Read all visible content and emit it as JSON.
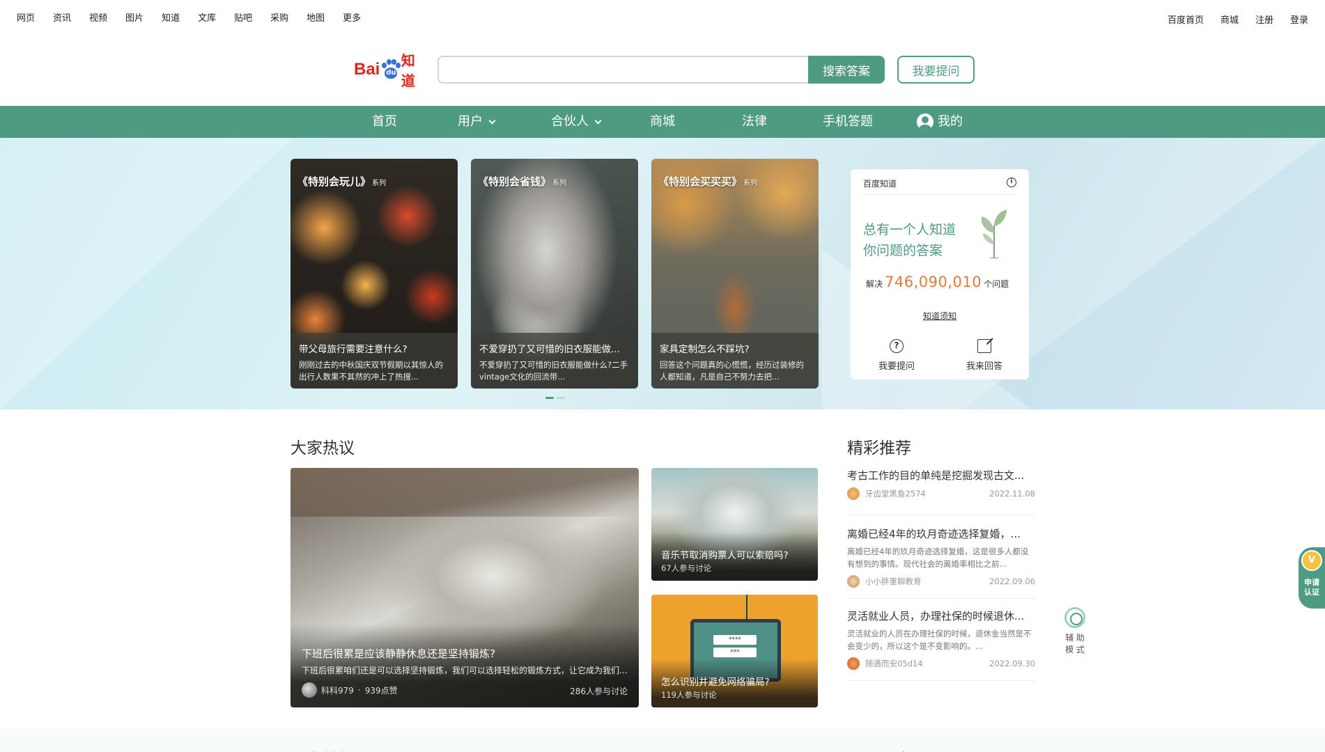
{
  "top_nav": {
    "left": [
      "网页",
      "资讯",
      "视频",
      "图片",
      "知道",
      "文库",
      "贴吧",
      "采购",
      "地图",
      "更多"
    ],
    "right": [
      "百度首页",
      "商城",
      "注册",
      "登录"
    ]
  },
  "logo": {
    "bai": "Bai",
    "du": "du",
    "zhidao": "知道"
  },
  "search": {
    "value": "",
    "placeholder": "",
    "button": "搜索答案",
    "ask_button": "我要提问"
  },
  "main_nav": {
    "home": "首页",
    "user": "用户",
    "partner": "合伙人",
    "mall": "商城",
    "law": "法律",
    "mobile": "手机答题",
    "mine": "我的"
  },
  "carousel": [
    {
      "series": "《特别会玩儿》",
      "tag": "系列",
      "title": "带父母旅行需要注意什么?",
      "desc": "刚刚过去的中秋国庆双节假期以其惊人的出行人数果不其然的冲上了热搜..."
    },
    {
      "series": "《特别会省钱》",
      "tag": "系列",
      "title": "不爱穿扔了又可惜的旧衣服能做...",
      "desc": "不爱穿扔了又可惜的旧衣服能做什么?二手vintage文化的回流带..."
    },
    {
      "series": "《特别会买买买》",
      "tag": "系列",
      "title": "家具定制怎么不踩坑?",
      "desc": "回答这个问题真的心慌慌，经历过装修的人都知道，凡是自己不努力去把..."
    }
  ],
  "intro": {
    "header": "百度知道",
    "info_icon": "i",
    "slogan_line1": "总有一个人知道",
    "slogan_line2": "你问题的答案",
    "solved_prefix": "解决",
    "solved_count": "746,090,010",
    "solved_suffix": "个问题",
    "notice": "知道须知",
    "ask": "我要提问",
    "answer": "我来回答"
  },
  "hot": {
    "title": "大家热议",
    "main": {
      "title": "下班后很累是应该静静休息还是坚持锻炼?",
      "desc": "下班后很累咱们还是可以选择坚持锻炼，我们可以选择轻松的锻炼方式，让它成为我们...",
      "author": "科科979",
      "likes": "939点赞",
      "join": "286人参与讨论"
    },
    "side1": {
      "title": "音乐节取消购票人可以索赔吗?",
      "join": "67人参与讨论"
    },
    "side2": {
      "title": "怎么识别并避免网络骗局?",
      "join": "119人参与讨论",
      "pw1": "****",
      "pw2": "***"
    }
  },
  "recommend": {
    "title": "精彩推荐",
    "items": [
      {
        "title": "考古工作的目的单纯是挖掘发现古文...",
        "desc": "",
        "author": "牙齿堂黑鱼2574",
        "date": "2022.11.08"
      },
      {
        "title": "离婚已经4年的玖月奇迹选择复婚，...",
        "desc": "离婚已经4年的玖月奇迹选择复婚，这是很多人都没有想到的事情。现代社会的离婚率相比之前...",
        "author": "小小胖重聊教育",
        "date": "2022.09.06"
      },
      {
        "title": "灵活就业人员，办理社保的时候退休...",
        "desc": "灵活就业的人员在办理社保的时候，退休金当然是不会变少的，所以这个是不变影响的。...",
        "author": "随遇而安05d14",
        "date": "2022.09.30"
      }
    ]
  },
  "side_tool": {
    "line1": "辅 助",
    "line2": "模 式"
  },
  "cert": {
    "badge": "V",
    "text": "申请认证"
  },
  "bottom": {
    "left": "财富排行",
    "right": "活动公告"
  },
  "colors": {
    "brand_green": "#4e9a82",
    "logo_red": "#e1251b",
    "accent_orange": "#e27a3f"
  }
}
